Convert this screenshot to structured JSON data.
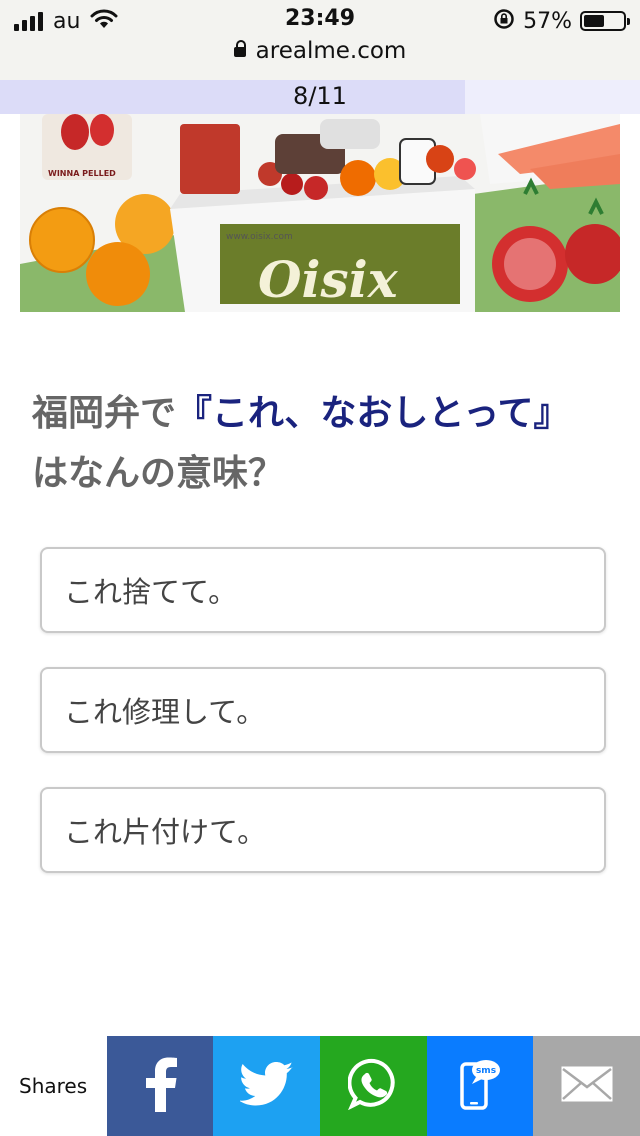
{
  "status_bar": {
    "carrier": "au",
    "time": "23:49",
    "battery_percent": "57%",
    "battery_level": 0.57,
    "url": "arealme.com"
  },
  "progress": {
    "label": "8/11",
    "fraction": 0.727
  },
  "hero": {
    "brand": "Oisix",
    "url_text": "www.oisix.com",
    "can_label": "WINNA PELLED"
  },
  "question": {
    "prefix": "福岡弁で",
    "highlight": "『これ、なおしとって』",
    "suffix": " はなんの意味？"
  },
  "answers": [
    {
      "label": "これ捨てて。"
    },
    {
      "label": "これ修理して。"
    },
    {
      "label": "これ片付けて。"
    }
  ],
  "share": {
    "label": "Shares",
    "buttons": [
      {
        "name": "facebook",
        "color": "#3b5998"
      },
      {
        "name": "twitter",
        "color": "#1da1f2"
      },
      {
        "name": "whatsapp",
        "color": "#25a81f"
      },
      {
        "name": "sms",
        "color": "#0a7cff",
        "text": "sms"
      },
      {
        "name": "email",
        "color": "#a8a8a8"
      }
    ]
  }
}
